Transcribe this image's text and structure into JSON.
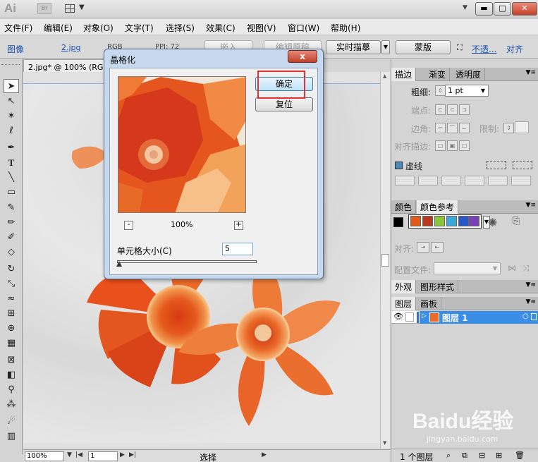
{
  "app": {
    "logo": "Ai",
    "bridge": "Br"
  },
  "menu": [
    "文件(F)",
    "编辑(E)",
    "对象(O)",
    "文字(T)",
    "选择(S)",
    "效果(C)",
    "视图(V)",
    "窗口(W)",
    "帮助(H)"
  ],
  "control_bar": {
    "type_label": "图像",
    "file_link": "2.jpg",
    "color_mode": "RGB",
    "ppi": "PPI: 72",
    "embed_btn": "嵌入",
    "edit_original_btn": "编辑原稿",
    "live_trace_btn": "实时描摹",
    "mask_btn": "蒙版",
    "opacity_link": "不透...",
    "align_link": "对齐"
  },
  "document": {
    "tab_title": "2.jpg* @ 100% (RGB/预览)"
  },
  "status_bar": {
    "zoom": "100%",
    "page": "1",
    "status": "选择"
  },
  "dialog": {
    "title": "晶格化",
    "close_label": "x",
    "ok_label": "确定",
    "reset_label": "复位",
    "zoom_out": "-",
    "zoom_in": "+",
    "zoom_pct": "100%",
    "cell_size_label": "单元格大小(C)",
    "cell_size_value": "5"
  },
  "stroke_panel": {
    "tabs": [
      "描边",
      "渐变",
      "透明度"
    ],
    "weight_label": "粗细:",
    "weight_value": "1 pt",
    "cap_label": "端点:",
    "corner_label": "边角:",
    "limit_label": "限制:",
    "align_label": "对齐描边:",
    "dashed_label": "虚线"
  },
  "color_panel": {
    "tabs": [
      "颜色",
      "颜色参考"
    ],
    "swatch_colors": [
      "#e05a1a",
      "#b83820",
      "#8cc43a",
      "#3aa8d8",
      "#2a58c8",
      "#7a40b8"
    ],
    "align_label": "对齐:",
    "profile_label": "配置文件:"
  },
  "appearance_panel": {
    "tabs": [
      "外观",
      "图形样式"
    ]
  },
  "layers_panel": {
    "tabs": [
      "图层",
      "画板"
    ],
    "layer_name": "图层 1",
    "footer": "1 个图层"
  },
  "watermark": {
    "main": "Baidu经验",
    "sub": "jingyan.baidu.com"
  }
}
